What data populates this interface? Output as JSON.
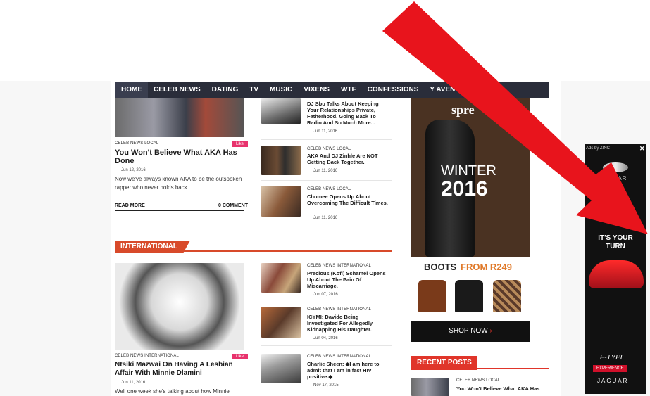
{
  "nav": {
    "items": [
      "HOME",
      "CELEB NEWS",
      "DATING",
      "TV",
      "MUSIC",
      "VIXENS",
      "WTF",
      "CONFESSIONS",
      "Y AVENUE STORIES"
    ]
  },
  "featured": {
    "tags": "CELEB NEWS  LOCAL",
    "like": "Like",
    "title": "You Won't Believe What AKA Has Done",
    "date": "Jun 12, 2016",
    "excerpt": "Now we've always known AKA to be the outspoken rapper who never holds back....",
    "read_more": "READ MORE",
    "comments": "0 COMMENT"
  },
  "top_list": [
    {
      "tags": "",
      "title": "DJ Sbu Talks About Keeping Your Relationships Private, Fatherhood, Going Back To Radio And So Much More...",
      "date": "Jun 11, 2016"
    },
    {
      "tags": "CELEB NEWS  LOCAL",
      "title": "AKA And DJ Zinhle Are NOT Getting Back Together.",
      "date": "Jun 11, 2016"
    },
    {
      "tags": "CELEB NEWS  LOCAL",
      "title": "Chomee Opens Up About Overcoming The Difficult Times.",
      "date": "Jun 11, 2016"
    }
  ],
  "section": {
    "label": "INTERNATIONAL"
  },
  "intl_featured": {
    "tags": "CELEB NEWS  INTERNATIONAL",
    "like": "Like",
    "title": "Ntsiki Mazwai On Having A Lesbian Affair With Minnie Dlamini",
    "date": "Jun 11, 2016",
    "excerpt": "Well one week she's talking about how Minnie"
  },
  "intl_list": [
    {
      "tags": "CELEB NEWS  INTERNATIONAL",
      "title": "Precious (Kofi) Schamel Opens Up About The Pain Of Miscarriage.",
      "date": "Jun 07, 2016"
    },
    {
      "tags": "CELEB NEWS  INTERNATIONAL",
      "title": "ICYMI: Davido Being Investigated For Allegedly Kidnapping His Daughter.",
      "date": "Jun 04, 2016"
    },
    {
      "tags": "CELEB NEWS  INTERNATIONAL",
      "title": "Charlie Sheen: ◆I am here to admit that I am in fact HIV positive.◆",
      "date": "Nov 17, 2015"
    }
  ],
  "ad": {
    "brand": "spre",
    "season": "WINTER",
    "year": "2016",
    "boots": "BOOTS",
    "from": "FROM R249",
    "cta": "SHOP NOW"
  },
  "recent": {
    "label": "RECENT POSTS",
    "tags": "CELEB NEWS  LOCAL",
    "title": "You Won't Believe What AKA Has"
  },
  "side_ad": {
    "top": "Ads by ZINC",
    "brand_top": "JAGUAR",
    "headline1": "IT'S YOUR",
    "headline2": "TURN",
    "model": "F-TYPE",
    "badge": "EXPERIENCE",
    "brand_bottom": "JAGUAR"
  },
  "colors": {
    "nav": "#2a2d3a",
    "accent": "#d84a2a",
    "like": "#e8336d",
    "arrow": "#e8141c"
  }
}
